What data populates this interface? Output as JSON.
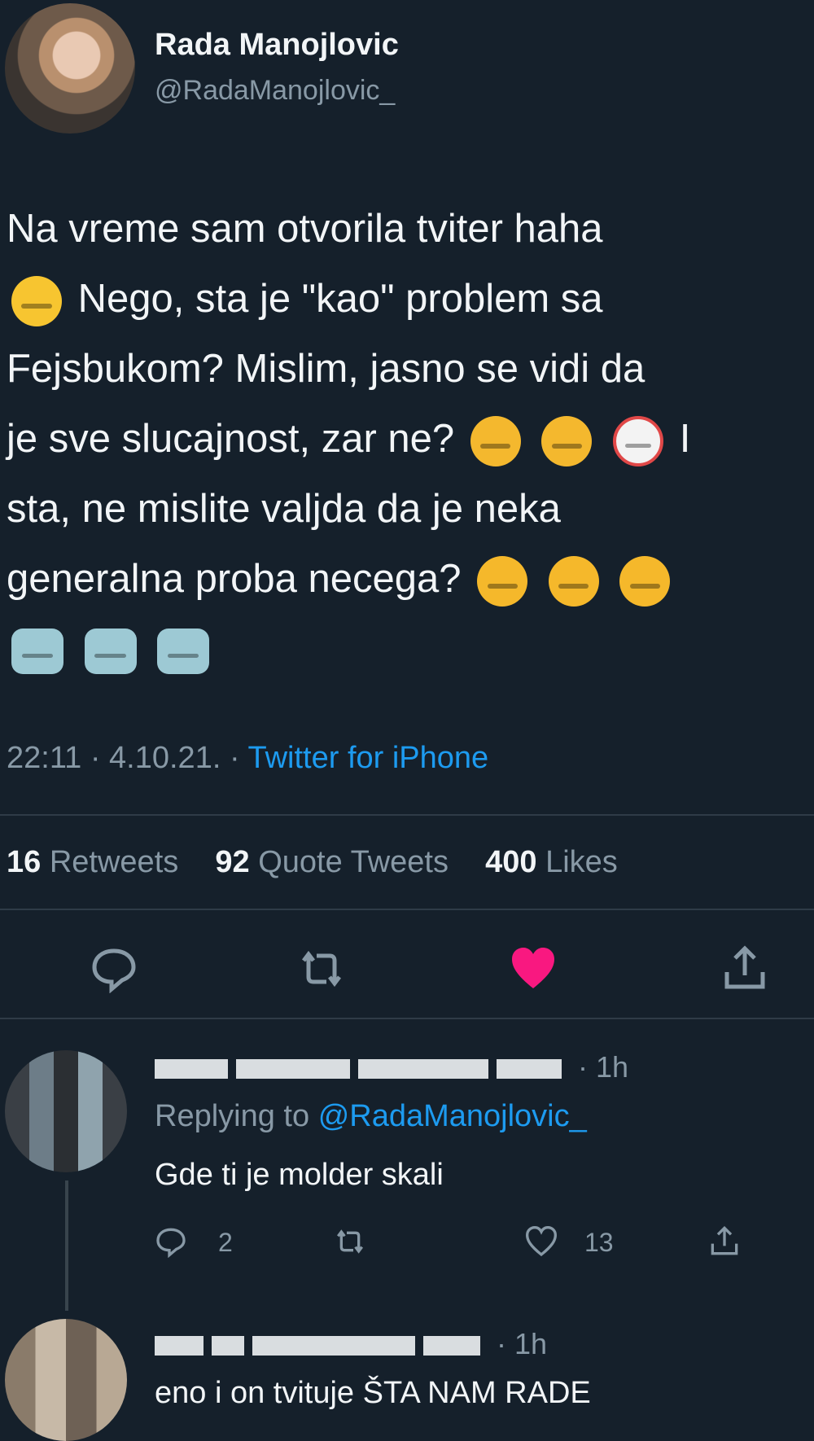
{
  "tweet": {
    "author_name": "Rada Manojlovic",
    "author_handle": "@RadaManojlovic_",
    "lines": [
      "Na vreme sam otvorila tviter haha",
      "Nego, sta je \"kao\" problem sa",
      "Fejsbukom? Mislim, jasno se vidi da",
      "je sve slucajnost, zar ne?",
      "sta, ne mislite valjda da je neka",
      "generalna proba necega?"
    ],
    "line4_trailing": "I",
    "time": "22:11 · 4.10.21. ·",
    "source": "Twitter for iPhone",
    "stats": {
      "retweets_count": "16",
      "retweets_label": "Retweets",
      "quotes_count": "92",
      "quotes_label": "Quote Tweets",
      "likes_count": "400",
      "likes_label": "Likes"
    },
    "actions": [
      "reply-icon",
      "retweet-icon",
      "like-icon-filled",
      "share-icon"
    ],
    "colors": {
      "background": "#15202b",
      "accent": "#1d9bf0",
      "like": "#f91880",
      "muted": "#8899a6"
    }
  },
  "replies": [
    {
      "time": "· 1h",
      "replying_prefix": "Replying to",
      "replying_handle": "@RadaManojlovic_",
      "text": "Gde ti je molder skali",
      "reply_count": "2",
      "like_count": "13"
    },
    {
      "time": "· 1h",
      "text": "eno i on tvituje ŠTA NAM RADE"
    }
  ]
}
